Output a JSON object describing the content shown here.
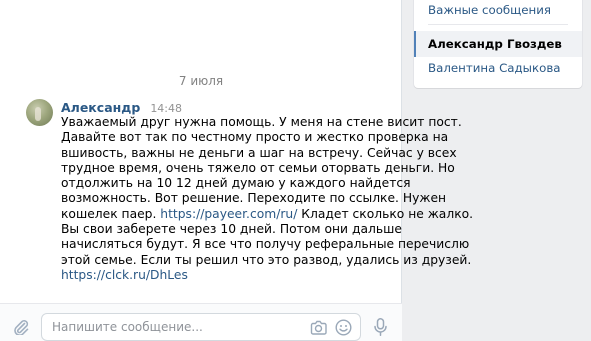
{
  "chat": {
    "date": "7 июля",
    "message": {
      "author": "Александр",
      "time": "14:48",
      "lines": [
        "Уважаемый друг нужна помощь. У меня на стене висит пост.",
        "Давайте вот так по честному просто и жестко проверка на",
        "вшивость, важны не деньги а шаг на встречу. Сейчас у всех",
        "трудное время, очень тяжело от семьи оторвать деньги. Но",
        "отдолжить на 10 12 дней думаю у каждого найдется",
        "возможность. Вот решение. Переходите по ссылке. Нужен"
      ],
      "line7_prefix": "кошелек паер. ",
      "line7_link": "https://payeer.com/ru/",
      "line7_suffix": " Кладет сколько не жалко.",
      "lines_rest": [
        "Вы свои заберете через 10 дней. Потом они дальше",
        "начисляться будут. Я все что получу реферальные перечислю",
        "этой семье. Если ты решил что это развод, удались из друзей."
      ],
      "final_link": "https://clck.ru/DhLes"
    }
  },
  "compose": {
    "placeholder": "Напишите сообщение..."
  },
  "sidebar": {
    "items": [
      {
        "label": "Важные сообщения"
      },
      {
        "label": "Александр Гвоздев"
      },
      {
        "label": "Валентина Садыкова"
      }
    ]
  },
  "colors": {
    "link": "#2a5885",
    "active_border": "#5181b8",
    "background": "#edeef0"
  },
  "icons": [
    "paperclip-icon",
    "camera-icon",
    "smile-icon",
    "microphone-icon"
  ]
}
